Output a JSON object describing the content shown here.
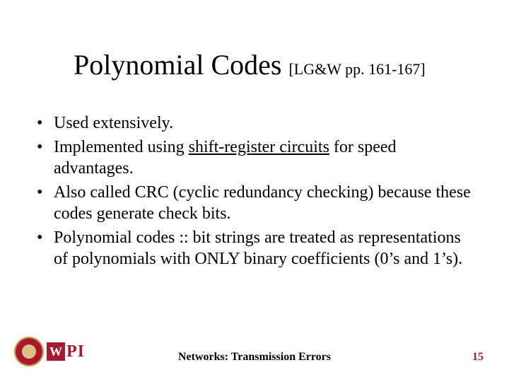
{
  "title": {
    "main": "Polynomial Codes",
    "ref": "[LG&W pp. 161-167]"
  },
  "bullets": {
    "b1": "Used extensively.",
    "b2a": "Implemented using ",
    "b2_underlined": "shift-register circuits",
    "b2b": " for speed advantages.",
    "b3": "Also called CRC (cyclic redundancy checking) because these codes generate check bits.",
    "b4": "Polynomial codes :: bit strings are treated as representations of polynomials with ONLY binary coefficients (0’s and 1’s)."
  },
  "footer": {
    "title": "Networks: Transmission Errors",
    "page": "15"
  },
  "logo": {
    "w": "W",
    "pi": "PI"
  }
}
